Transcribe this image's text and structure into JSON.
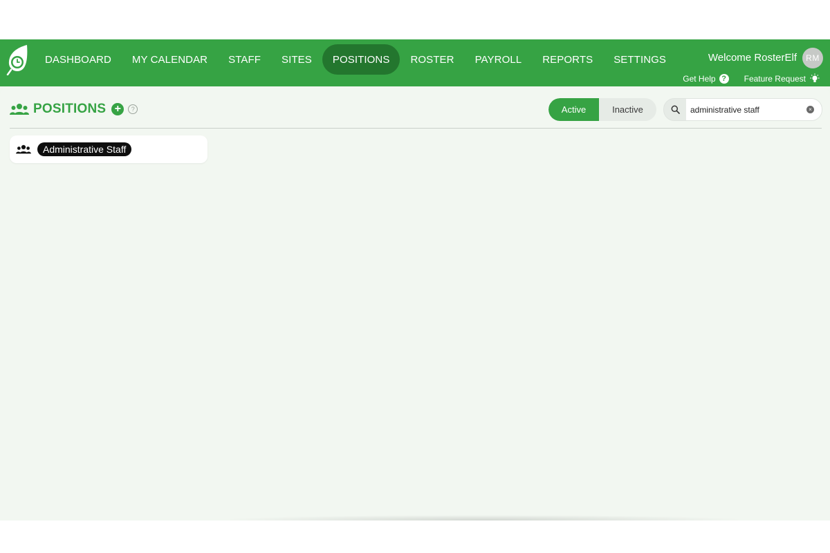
{
  "nav": {
    "items": [
      "DASHBOARD",
      "MY CALENDAR",
      "STAFF",
      "SITES",
      "POSITIONS",
      "ROSTER",
      "PAYROLL",
      "REPORTS",
      "SETTINGS"
    ],
    "active": "POSITIONS"
  },
  "user": {
    "welcome": "Welcome RosterElf",
    "initials": "RM"
  },
  "help": {
    "get_help": "Get Help",
    "feature_request": "Feature Request"
  },
  "page": {
    "title": "POSITIONS"
  },
  "filter": {
    "active_label": "Active",
    "inactive_label": "Inactive"
  },
  "search": {
    "value": "administrative staff"
  },
  "results": [
    {
      "name": "Administrative Staff"
    }
  ],
  "colors": {
    "brand_green": "#36a344",
    "nav_active": "#23762e",
    "content_bg": "#f2f7f1"
  },
  "icons": {
    "logo": "leaf-clock-logo",
    "title": "users-group-icon",
    "add": "plus-circle-icon",
    "info": "question-circle-icon",
    "help": "question-icon",
    "feature": "lightbulb-icon",
    "search": "search-icon",
    "clear": "clear-icon"
  }
}
